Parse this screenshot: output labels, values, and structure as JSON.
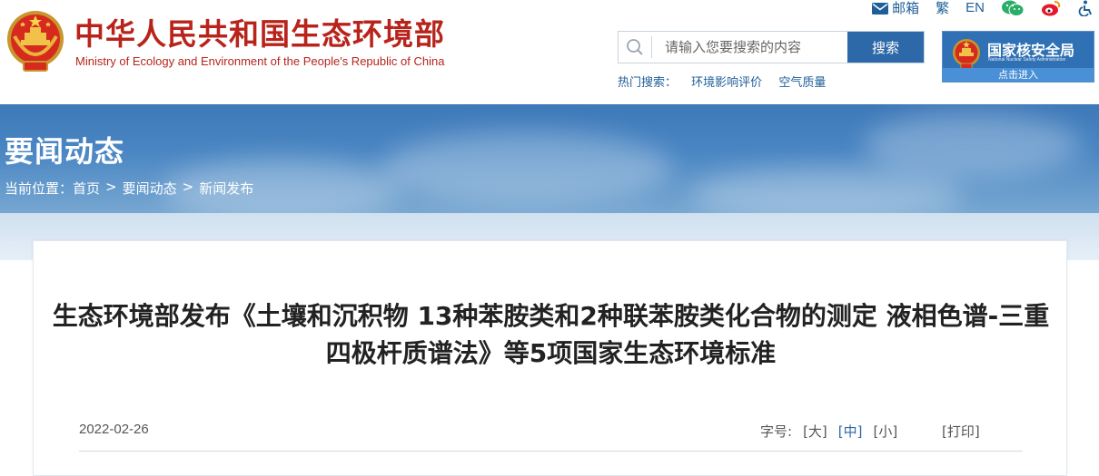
{
  "header": {
    "ministry_cn": "中华人民共和国生态环境部",
    "ministry_en": "Ministry of Ecology and Environment of the People's Republic of China",
    "emblem_icon": "national-emblem-icon"
  },
  "toplinks": {
    "mail_label": "邮箱",
    "traditional_label": "繁",
    "english_label": "EN",
    "icons": [
      "mail-icon",
      "wechat-icon",
      "weibo-icon",
      "accessibility-icon"
    ]
  },
  "search": {
    "placeholder": "请输入您要搜索的内容",
    "button_label": "搜索",
    "hot_label": "热门搜索：",
    "hot_items": [
      "环境影响评价",
      "空气质量"
    ]
  },
  "nnsa": {
    "name_cn": "国家核安全局",
    "name_en": "National Nuclear Safety Administration",
    "enter_label": "点击进入"
  },
  "banner": {
    "section_title": "要闻动态",
    "breadcrumb_prefix": "当前位置：",
    "breadcrumb": [
      "首页",
      "要闻动态",
      "新闻发布"
    ],
    "breadcrumb_sep": ">"
  },
  "article": {
    "title": "生态环境部发布《土壤和沉积物 13种苯胺类和2种联苯胺类化合物的测定 液相色谱-三重四极杆质谱法》等5项国家生态环境标准",
    "date": "2022-02-26",
    "font_size_label": "字号:",
    "font_size_options": [
      "[大]",
      "[中]",
      "[小]"
    ],
    "font_size_active": "[中]",
    "print_label": "[打印]"
  },
  "colors": {
    "brand_red": "#b8241b",
    "link_blue": "#1f5f99",
    "button_blue": "#2d69a8"
  }
}
